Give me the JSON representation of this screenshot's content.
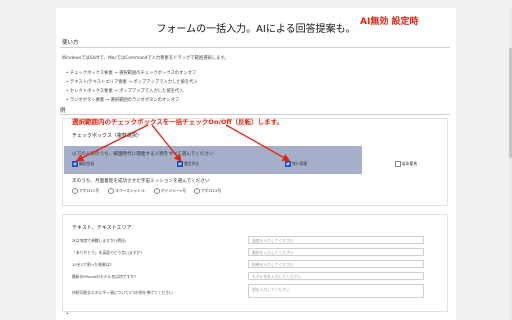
{
  "header": {
    "title": "フォームの一括入力。AIによる回答提案も。",
    "annotation_badge": "AI無効 設定時"
  },
  "usage": {
    "heading": "使い方",
    "description": "WindowsではShiftで、MacではCommandで入力要素をドラッグで範囲選択します。",
    "bullets": [
      "チェックボックス要素 → 選択範囲のチェックボックスのオンオフ",
      "テキスト/テキストエリア要素 → ポップアップで入力した値を代入",
      "セレクトボックス要素 → ポップアップで入力した値を代入",
      "ラジオボタン要素 → 選択範囲のラジオボタンのオンオフ"
    ]
  },
  "example": {
    "heading": "例",
    "annotation": "選択範囲内のチェックボックスを一括チェックOn/Off（反転）します。",
    "checkbox_section": {
      "heading": "チェックボックス（複数選択）",
      "question1": "以下の人物のうち、戦国時代に関連する人物をすべて選んでください",
      "options1": [
        {
          "label": "織田信長",
          "checked": true
        },
        {
          "label": "豊臣秀吉",
          "checked": true
        },
        {
          "label": "徳川家康",
          "checked": true
        },
        {
          "label": "坂本龍馬",
          "checked": false
        }
      ],
      "question2": "次のうち、月面着陸を成功させた宇宙ミッションを選んでください",
      "options2": [
        {
          "label": "アポロ11号"
        },
        {
          "label": "スペースシャトル"
        },
        {
          "label": "ボイジャー1号"
        },
        {
          "label": "アポロ13号"
        }
      ]
    },
    "text_section": {
      "heading": "テキスト、テキストエリア",
      "rows": [
        {
          "label": "水は何度で沸騰しますか?(摂氏)",
          "placeholder": "温度を入力してください"
        },
        {
          "label": "「ありがとう」を英語でどう言いますか?",
          "placeholder": "翻訳を入力してください"
        },
        {
          "label": "10を2で割った結果は?",
          "placeholder": "結果を入力してください"
        },
        {
          "label": "最新のiPhoneのモデル名は何ですか?",
          "placeholder": "モデル名を入力してください"
        }
      ],
      "textarea_label": "持続可能なエネルギー源について3つの例を挙げてください",
      "textarea_placeholder": "例を入力してください"
    }
  },
  "colors": {
    "annotation": "#e8230f",
    "highlight": "#a6afc9",
    "checkbox_checked": "#2a62d8"
  }
}
